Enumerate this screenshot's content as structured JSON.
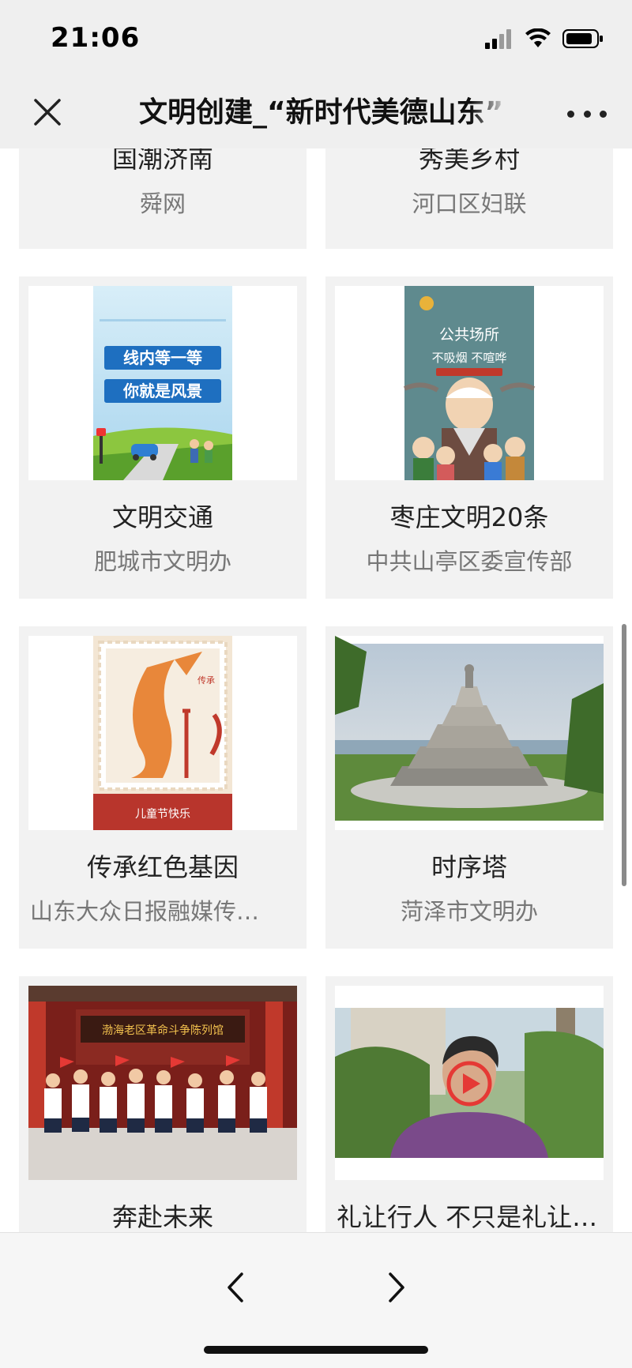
{
  "status_bar": {
    "time": "21:06"
  },
  "nav": {
    "title": "文明创建_“新时代美德山东”"
  },
  "cards": [
    {
      "title": "国潮济南",
      "source": "舜网"
    },
    {
      "title": "秀美乡村",
      "source": "河口区妇联"
    },
    {
      "title": "文明交通",
      "source": "肥城市文明办",
      "thumb_text": [
        "线内等一等",
        "你就是风景"
      ]
    },
    {
      "title": "枣庄文明20条",
      "source": "中共山亭区委宣传部",
      "thumb_text": [
        "公共场所",
        "不吸烟 不喧哗"
      ]
    },
    {
      "title": "传承红色基因",
      "source": "山东大众日报融媒传…",
      "thumb_text": [
        "儿童节快乐"
      ]
    },
    {
      "title": "时序塔",
      "source": "菏泽市文明办"
    },
    {
      "title": "奔赴未来",
      "source": "",
      "thumb_text": [
        "渤海老区革命斗争陈列馆"
      ]
    },
    {
      "title": "礼让行人 不只是礼让…",
      "source": ""
    }
  ],
  "colors": {
    "card_bg": "#f2f2f2",
    "bar_bg": "#efefef",
    "poster_blue": "#1e6fc0",
    "stamp_red": "#b8352c"
  }
}
